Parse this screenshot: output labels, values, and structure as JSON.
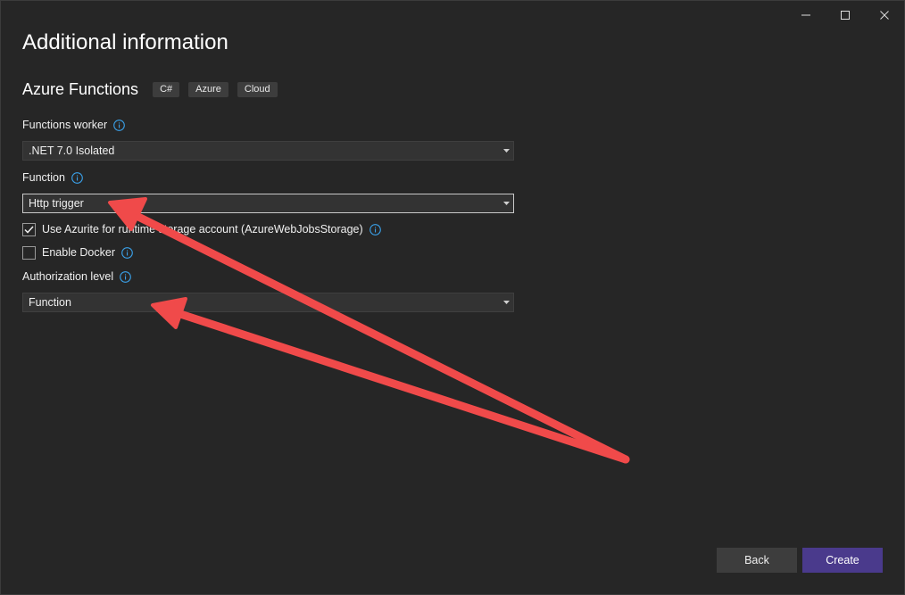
{
  "window": {
    "title": "Additional information"
  },
  "template": {
    "name": "Azure Functions",
    "tags": [
      "C#",
      "Azure",
      "Cloud"
    ]
  },
  "fields": {
    "worker": {
      "label": "Functions worker",
      "value": ".NET 7.0 Isolated"
    },
    "function": {
      "label": "Function",
      "value": "Http trigger"
    },
    "azurite": {
      "label": "Use Azurite for runtime storage account (AzureWebJobsStorage)",
      "checked": true
    },
    "docker": {
      "label": "Enable Docker",
      "checked": false
    },
    "auth_level": {
      "label": "Authorization level",
      "value": "Function"
    }
  },
  "buttons": {
    "back": "Back",
    "create": "Create"
  },
  "colors": {
    "background": "#262626",
    "accent": "#4a3a8c",
    "info_icon": "#3aa0e8",
    "annotation_arrow": "#f04a4a"
  }
}
